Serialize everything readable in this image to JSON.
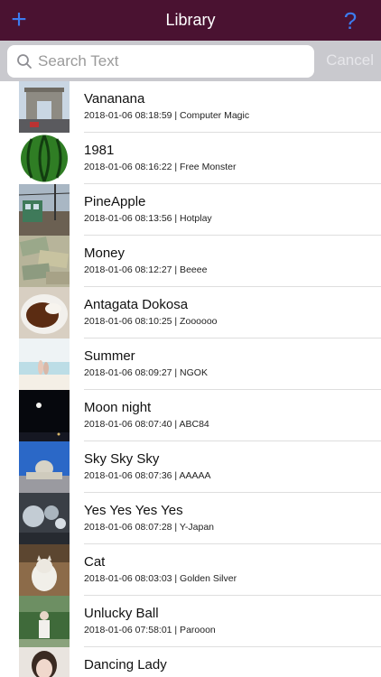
{
  "header": {
    "title": "Library",
    "add_icon": "+",
    "help_icon": "?"
  },
  "search": {
    "placeholder": "Search Text",
    "value": "",
    "cancel_label": "Cancel"
  },
  "items": [
    {
      "title": "Vananana",
      "subtitle": "2018-01-06 08:18:59 | Computer Magic",
      "thumb": "arch"
    },
    {
      "title": "1981",
      "subtitle": "2018-01-06 08:16:22 | Free Monster",
      "thumb": "watermelon"
    },
    {
      "title": "PineApple",
      "subtitle": "2018-01-06 08:13:56 | Hotplay",
      "thumb": "tram"
    },
    {
      "title": "Money",
      "subtitle": "2018-01-06 08:12:27 | Beeee",
      "thumb": "money"
    },
    {
      "title": "Antagata Dokosa",
      "subtitle": "2018-01-06 08:10:25 | Zoooooo",
      "thumb": "curry"
    },
    {
      "title": "Summer",
      "subtitle": "2018-01-06 08:09:27 | NGOK",
      "thumb": "beach"
    },
    {
      "title": "Moon night",
      "subtitle": "2018-01-06 08:07:40 | ABC84",
      "thumb": "moon"
    },
    {
      "title": "Sky Sky Sky",
      "subtitle": "2018-01-06 08:07:36 | AAAAA",
      "thumb": "city"
    },
    {
      "title": "Yes Yes Yes Yes",
      "subtitle": "2018-01-06 08:07:28 | Y-Japan",
      "thumb": "bubbles"
    },
    {
      "title": "Cat",
      "subtitle": "2018-01-06 08:03:03 | Golden Silver",
      "thumb": "cat"
    },
    {
      "title": "Unlucky Ball",
      "subtitle": "2018-01-06 07:58:01 | Parooon",
      "thumb": "girl-park"
    },
    {
      "title": "Dancing Lady",
      "subtitle": "",
      "thumb": "girl-portrait"
    }
  ]
}
